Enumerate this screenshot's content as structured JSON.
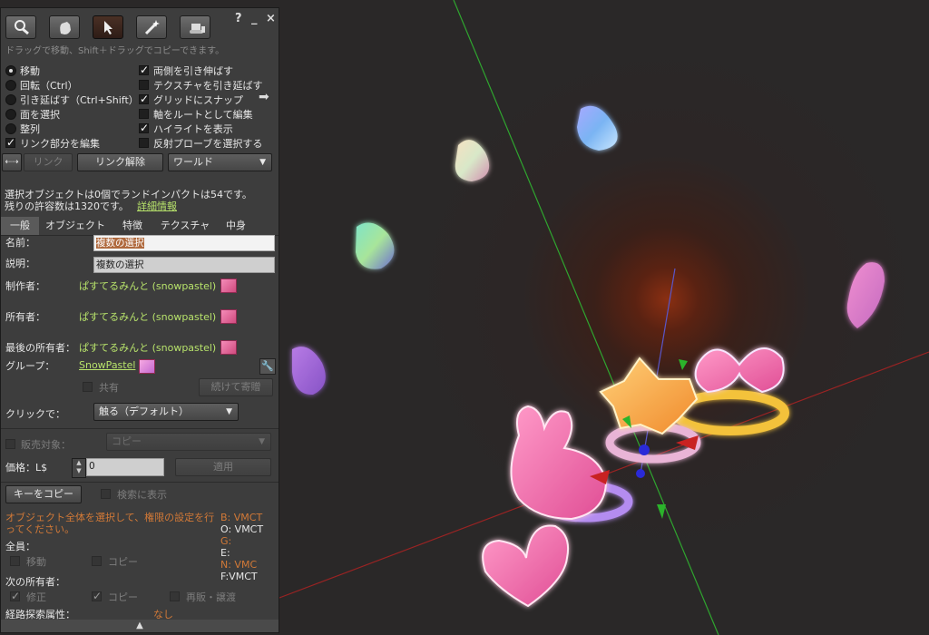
{
  "panel": {
    "controls": {
      "help": "?",
      "minimize": "_",
      "close": "×"
    },
    "hint": "ドラッグで移動、Shift＋ドラッグでコピーできます。",
    "edit_modes": [
      {
        "label": "移動",
        "selected": true
      },
      {
        "label": "回転（Ctrl）",
        "selected": false
      },
      {
        "label": "引き延ばす（Ctrl+Shift）",
        "selected": false
      },
      {
        "label": "面を選択",
        "selected": false
      },
      {
        "label": "整列",
        "selected": false
      }
    ],
    "edit_linked": {
      "label": "リンク部分を編集",
      "checked": true
    },
    "options": [
      {
        "label": "両側を引き伸ばす",
        "checked": true
      },
      {
        "label": "テクスチャを引き延ばす",
        "checked": false
      },
      {
        "label": "グリッドにスナップ",
        "checked": true
      },
      {
        "label": "軸をルートとして編集",
        "checked": false
      },
      {
        "label": "ハイライトを表示",
        "checked": true
      },
      {
        "label": "反射プローブを選択する",
        "checked": false
      }
    ],
    "link_button": "リンク",
    "unlink_button": "リンク解除",
    "ruler_select": "ワールド",
    "selection_info_1": "選択オブジェクトは0個でランドインパクトは54です。",
    "selection_info_2": "残りの許容数は1320です。",
    "more_info": "詳細情報",
    "tabs": [
      "一般",
      "オブジェクト",
      "特徴",
      "テクスチャ",
      "中身"
    ],
    "general": {
      "name_label": "名前：",
      "name_value": "複数の選択",
      "desc_label": "説明：",
      "desc_value": "複数の選択",
      "creator_label": "制作者：",
      "creator_value": "ぱすてるみんと (snowpastel)",
      "owner_label": "所有者：",
      "owner_value": "ぱすてるみんと (snowpastel)",
      "last_owner_label": "最後の所有者：",
      "last_owner_value": "ぱすてるみんと (snowpastel)",
      "group_label": "グループ：",
      "group_value": "SnowPastel",
      "share_label": "共有",
      "deed_button": "続けて寄贈",
      "click_label": "クリックで：",
      "click_value": "触る（デフォルト）",
      "for_sale_label": "販売対象：",
      "sale_type": "コピー",
      "price_label": "価格：L$",
      "price_value": "0",
      "apply_button": "適用",
      "copy_keys_button": "キーをコピー",
      "show_in_search_label": "検索に表示",
      "perm_notice": "オブジェクト全体を選択して、権限の設定を行ってください。",
      "everyone_label": "全員：",
      "everyone_move": "移動",
      "everyone_copy": "コピー",
      "next_owner_label": "次の所有者：",
      "next_modify": "修正",
      "next_copy": "コピー",
      "next_resell": "再販・譲渡",
      "pathfinding_label": "経路探索属性：",
      "pathfinding_value": "なし",
      "perm_codes": [
        "B: VMCT",
        "O: VMCT",
        "G:",
        "E:",
        "N: VMC",
        "F:VMCT"
      ]
    }
  }
}
